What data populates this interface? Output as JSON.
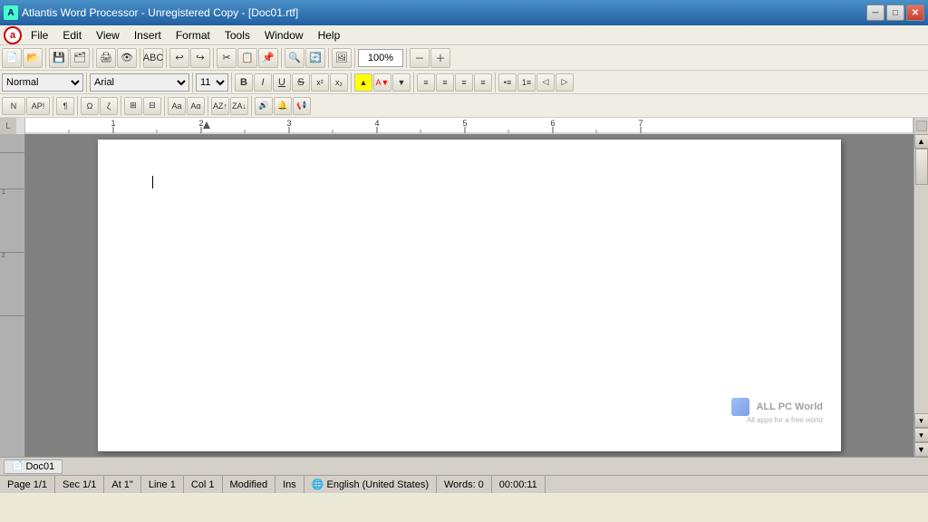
{
  "titlebar": {
    "title": "Atlantis Word Processor - Unregistered Copy - [Doc01.rtf]",
    "min_label": "─",
    "max_label": "□",
    "close_label": "✕"
  },
  "menubar": {
    "items": [
      "File",
      "Edit",
      "View",
      "Insert",
      "Format",
      "Tools",
      "Window",
      "Help"
    ]
  },
  "toolbar1": {
    "zoom_value": "100%",
    "zoom_label": "100%"
  },
  "toolbar2": {
    "style_value": "Normal",
    "font_value": "Arial",
    "size_value": "11",
    "bold_label": "B",
    "italic_label": "I",
    "underline_label": "U"
  },
  "ruler": {
    "marks": [
      "1",
      "2",
      "3",
      "4",
      "5",
      "6",
      "7"
    ]
  },
  "document": {
    "name": "Doc01"
  },
  "statusbar": {
    "page": "Page 1/1",
    "sec": "Sec 1/1",
    "at": "At 1\"",
    "line": "Line 1",
    "col": "Col 1",
    "modified": "Modified",
    "ins": "Ins",
    "language": "English (United States)",
    "words": "Words: 0",
    "time": "00:00:11"
  },
  "scrollbar": {
    "up_arrow": "▲",
    "down_arrow": "▼",
    "left_arrow": "◄",
    "right_arrow": "►"
  },
  "watermark": {
    "line1": "ALL PC World",
    "line2": "All apps for a free world"
  }
}
